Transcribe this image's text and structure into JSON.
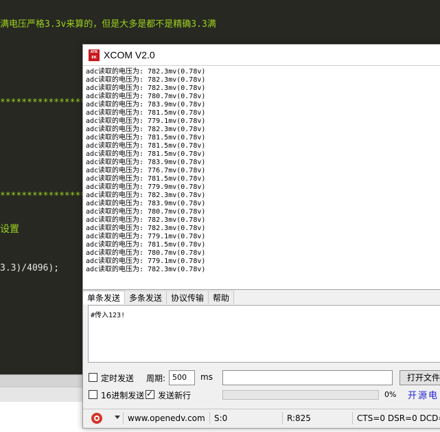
{
  "editor": {
    "line1": "满电压严格3.3v来算的，但是大多是都不是精确3.3满",
    "line2": "****************",
    "line3": "****************",
    "line4": "设置",
    "line5": "3.3)/4096);",
    "colors": {
      "background": "#272822",
      "comment": "#9bd11f",
      "text": "#e8e8e8"
    }
  },
  "xcom": {
    "title": "XCOM V2.0",
    "logo_text": "ALIENTEK",
    "rx_lines": [
      "adc读取的电压为: 782.3mv(0.78v)",
      "adc读取的电压为: 782.3mv(0.78v)",
      "adc读取的电压为: 782.3mv(0.78v)",
      "adc读取的电压为: 780.7mv(0.78v)",
      "adc读取的电压为: 783.9mv(0.78v)",
      "adc读取的电压为: 781.5mv(0.78v)",
      "adc读取的电压为: 779.1mv(0.78v)",
      "adc读取的电压为: 782.3mv(0.78v)",
      "adc读取的电压为: 781.5mv(0.78v)",
      "adc读取的电压为: 781.5mv(0.78v)",
      "adc读取的电压为: 781.5mv(0.78v)",
      "adc读取的电压为: 783.9mv(0.78v)",
      "adc读取的电压为: 776.7mv(0.78v)",
      "adc读取的电压为: 781.5mv(0.78v)",
      "adc读取的电压为: 779.9mv(0.78v)",
      "adc读取的电压为: 782.3mv(0.78v)",
      "adc读取的电压为: 783.9mv(0.78v)",
      "adc读取的电压为: 780.7mv(0.78v)",
      "adc读取的电压为: 782.3mv(0.78v)",
      "adc读取的电压为: 782.3mv(0.78v)",
      "adc读取的电压为: 779.1mv(0.78v)",
      "adc读取的电压为: 781.5mv(0.78v)",
      "adc读取的电压为: 780.7mv(0.78v)",
      "adc读取的电压为: 779.1mv(0.78v)",
      "adc读取的电压为: 782.3mv(0.78v)"
    ],
    "tabs": [
      "单条发送",
      "多条发送",
      "协议传输",
      "帮助"
    ],
    "tx_text": "#传入123!",
    "timed_send_label": "定时发送",
    "period_label": "周期:",
    "period_value": "500",
    "period_unit": "ms",
    "open_file_label": "打开文件",
    "hex_send_label": "16进制发送",
    "newline_send_label": "发送新行",
    "progress_label": "0%",
    "progress_value": 0,
    "brand_text": "开源电",
    "status": {
      "url": "www.openedv.com",
      "sent": "S:0",
      "received": "R:825",
      "signals": "CTS=0 DSR=0 DCD="
    },
    "colors": {
      "brand": "#1f1fd6",
      "record": "#d3352a"
    }
  }
}
